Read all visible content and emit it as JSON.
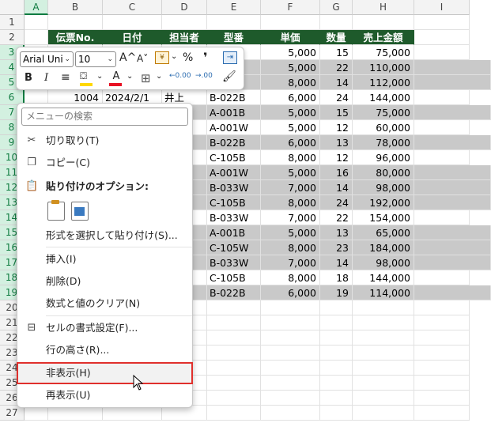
{
  "columns": [
    "A",
    "B",
    "C",
    "D",
    "E",
    "F",
    "G",
    "H",
    "I"
  ],
  "rows": [
    "1",
    "2",
    "3",
    "4",
    "5",
    "6",
    "7",
    "8",
    "9",
    "10",
    "11",
    "12",
    "13",
    "14",
    "15",
    "16",
    "17",
    "18",
    "19",
    "20",
    "21",
    "22",
    "23",
    "24",
    "25",
    "26",
    "27"
  ],
  "table_header": [
    "伝票No.",
    "日付",
    "担当者",
    "型番",
    "単価",
    "数量",
    "売上金額"
  ],
  "table_rows": [
    {
      "no": "",
      "date": "",
      "staff": "",
      "model": "B",
      "price": "5,000",
      "qty": "15",
      "amount": "75,000"
    },
    {
      "no": "",
      "date": "",
      "staff": "",
      "model": "W",
      "price": "5,000",
      "qty": "22",
      "amount": "110,000"
    },
    {
      "no": "",
      "date": "",
      "staff": "",
      "model": "W",
      "price": "8,000",
      "qty": "14",
      "amount": "112,000"
    },
    {
      "no": "1004",
      "date": "2024/2/1",
      "staff": "井上",
      "model": "B-022B",
      "price": "6,000",
      "qty": "24",
      "amount": "144,000"
    },
    {
      "no": "",
      "date": "",
      "staff": "",
      "model": "A-001B",
      "price": "5,000",
      "qty": "15",
      "amount": "75,000"
    },
    {
      "no": "",
      "date": "",
      "staff": "",
      "model": "A-001W",
      "price": "5,000",
      "qty": "12",
      "amount": "60,000"
    },
    {
      "no": "",
      "date": "",
      "staff": "",
      "model": "B-022B",
      "price": "6,000",
      "qty": "13",
      "amount": "78,000"
    },
    {
      "no": "",
      "date": "",
      "staff": "",
      "model": "C-105B",
      "price": "8,000",
      "qty": "12",
      "amount": "96,000"
    },
    {
      "no": "",
      "date": "",
      "staff": "",
      "model": "A-001W",
      "price": "5,000",
      "qty": "16",
      "amount": "80,000"
    },
    {
      "no": "",
      "date": "",
      "staff": "",
      "model": "B-033W",
      "price": "7,000",
      "qty": "14",
      "amount": "98,000"
    },
    {
      "no": "",
      "date": "",
      "staff": "",
      "model": "C-105B",
      "price": "8,000",
      "qty": "24",
      "amount": "192,000"
    },
    {
      "no": "",
      "date": "",
      "staff": "",
      "model": "B-033W",
      "price": "7,000",
      "qty": "22",
      "amount": "154,000"
    },
    {
      "no": "",
      "date": "",
      "staff": "",
      "model": "A-001B",
      "price": "5,000",
      "qty": "13",
      "amount": "65,000"
    },
    {
      "no": "",
      "date": "",
      "staff": "",
      "model": "C-105W",
      "price": "8,000",
      "qty": "23",
      "amount": "184,000"
    },
    {
      "no": "",
      "date": "",
      "staff": "",
      "model": "B-033W",
      "price": "7,000",
      "qty": "14",
      "amount": "98,000"
    },
    {
      "no": "",
      "date": "",
      "staff": "",
      "model": "C-105B",
      "price": "8,000",
      "qty": "18",
      "amount": "144,000"
    },
    {
      "no": "",
      "date": "",
      "staff": "",
      "model": "B-022B",
      "price": "6,000",
      "qty": "19",
      "amount": "114,000"
    }
  ],
  "gray_rows": [
    1,
    2,
    4,
    6,
    8,
    9,
    10,
    12,
    13,
    14,
    16
  ],
  "minibar": {
    "font_name": "Arial Uni",
    "font_size": "10",
    "grow": "A^",
    "shrink": "A˅",
    "percent": "%",
    "comma": "❜",
    "bold": "B",
    "italic": "I",
    "decimal_inc": "←0.00",
    "decimal_dec": "→.00",
    "font_color": "#e81123",
    "fill_color": "#ffd800"
  },
  "menu": {
    "search_placeholder": "メニューの検索",
    "cut": "切り取り(T)",
    "copy": "コピー(C)",
    "paste_options": "貼り付けのオプション:",
    "paste_special": "形式を選択して貼り付け(S)...",
    "insert": "挿入(I)",
    "delete": "削除(D)",
    "clear": "数式と値のクリア(N)",
    "format_cells": "セルの書式設定(F)...",
    "row_height": "行の高さ(R)...",
    "hide": "非表示(H)",
    "unhide": "再表示(U)"
  }
}
